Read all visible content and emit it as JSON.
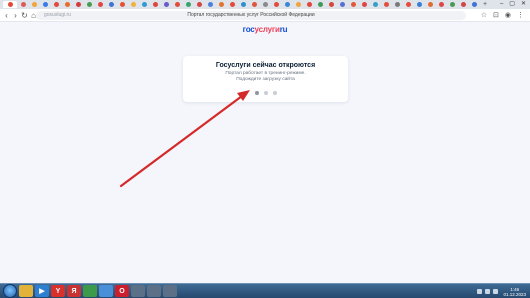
{
  "browser": {
    "tab_favicon_colors": [
      "#e3483c",
      "#e05a5a",
      "#f2a33a",
      "#3b7be6",
      "#e0493b",
      "#e86c2c",
      "#d23c3c",
      "#4a9d4e",
      "#e04646",
      "#3f74d6",
      "#e35235",
      "#f0b23a",
      "#2e9bd6",
      "#e0463e",
      "#6a5acd",
      "#e34c3a",
      "#3aa36b",
      "#d64545",
      "#4f7fd9",
      "#e2732e",
      "#e24a3b",
      "#2f8fd0",
      "#e0553d",
      "#8a8a8a",
      "#e34b3b",
      "#3b86d6",
      "#f2a33a",
      "#e0463e",
      "#3d9b57",
      "#d6463d",
      "#5a6fd6",
      "#e4583a",
      "#e04646",
      "#34a0c9",
      "#e2503c",
      "#7a7a7a",
      "#e34b3b",
      "#3a7fd4",
      "#e56a32",
      "#e04646",
      "#4c9a52",
      "#d64545",
      "#3f74d6"
    ],
    "new_tab_label": "+",
    "window_controls": {
      "minimize": "–",
      "maximize": "▢",
      "close": "✕"
    },
    "nav": {
      "back": "‹",
      "forward": "›",
      "reload": "↻",
      "home": "⌂"
    },
    "url_text": "gosuslugi.ru",
    "page_title": "Портал государственных услуг Российской Федерации",
    "toolbar_right": {
      "star": "☆",
      "extensions": "⊡",
      "profile": "◉",
      "menu": "⋮"
    }
  },
  "page": {
    "logo_part1": "гос",
    "logo_part2": "услуги",
    "logo_part3": "ru",
    "card": {
      "title": "Госуслуги сейчас откроются",
      "line1": "Портал работает в тренинг-режиме.",
      "line2": "Подождите загрузку сайта"
    },
    "loader_dots": 3,
    "loader_active_dot": 1
  },
  "taskbar": {
    "icons": [
      {
        "name": "explorer",
        "label": "",
        "color": "#e2b23a"
      },
      {
        "name": "media",
        "label": "▶",
        "color": "#2f7fd0"
      },
      {
        "name": "yandex",
        "label": "Y",
        "color": "#d9302c"
      },
      {
        "name": "red-app",
        "label": "Я",
        "color": "#c83232"
      },
      {
        "name": "green-app",
        "label": "",
        "color": "#3c9a4b"
      },
      {
        "name": "chrome",
        "label": "",
        "color": "#4a90d9"
      },
      {
        "name": "opera",
        "label": "O",
        "color": "#cc1f2d"
      },
      {
        "name": "app-8",
        "label": "",
        "color": "#5b6f86"
      },
      {
        "name": "app-9",
        "label": "",
        "color": "#5b6f86"
      },
      {
        "name": "app-10",
        "label": "",
        "color": "#5b6f86"
      }
    ],
    "clock_time": "1:46",
    "clock_date": "01.12.2023"
  }
}
